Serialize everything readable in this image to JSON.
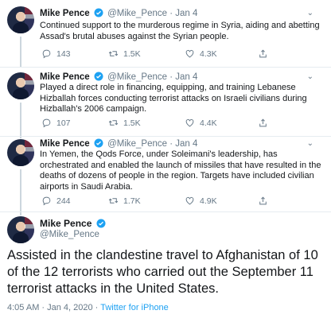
{
  "tweets": [
    {
      "name": "Mike Pence",
      "handle": "@Mike_Pence",
      "date": "· Jan 4",
      "text": "Continued support to the murderous regime in Syria, aiding and abetting Assad's brutal abuses against the Syrian people.",
      "replies": "143",
      "retweets": "1.5K",
      "likes": "4.3K"
    },
    {
      "name": "Mike Pence",
      "handle": "@Mike_Pence",
      "date": "· Jan 4",
      "text": "Played a direct role in financing, equipping, and training Lebanese Hizballah forces conducting terrorist attacks on Israeli civilians during Hizballah's 2006 campaign.",
      "replies": "107",
      "retweets": "1.5K",
      "likes": "4.4K"
    },
    {
      "name": "Mike Pence",
      "handle": "@Mike_Pence",
      "date": "· Jan 4",
      "text": "In Yemen, the Qods Force, under Soleimani's leadership, has orchestrated and enabled the launch of missiles that have resulted in the deaths of dozens of people in the region.  Targets have included civilian airports in Saudi Arabia.",
      "replies": "244",
      "retweets": "1.7K",
      "likes": "4.9K"
    }
  ],
  "main": {
    "name": "Mike Pence",
    "handle": "@Mike_Pence",
    "text": "Assisted in the clandestine travel to Afghanistan of 10 of the 12 terrorists who carried out the September 11 terrorist attacks in the United States.",
    "timestamp": "4:05 AM · Jan 4, 2020 · ",
    "source": "Twitter for iPhone"
  },
  "icons": {
    "reply": "reply-icon",
    "retweet": "retweet-icon",
    "like": "like-icon",
    "share": "share-icon",
    "verified": "verified-badge-icon",
    "caret": "chevron-down-icon"
  },
  "colors": {
    "text": "#14171a",
    "muted": "#657786",
    "verified": "#1da1f2",
    "divider": "#e6ecf0"
  }
}
